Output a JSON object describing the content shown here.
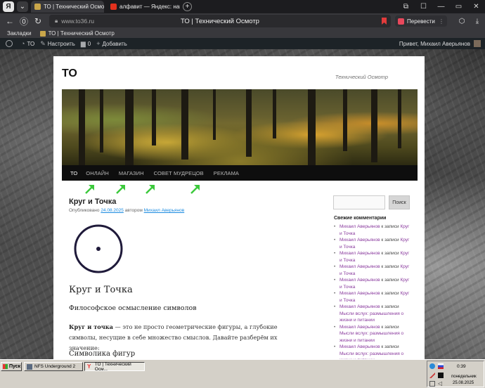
{
  "browser": {
    "tabs": [
      {
        "label": "ТО | Технический Осмотр",
        "active": true
      },
      {
        "label": "алфавит — Яндекс: нашлось",
        "active": false
      }
    ],
    "url": "www.to36.ru",
    "page_title": "ТО | Технический Осмотр",
    "translate_label": "Перевести",
    "bookmarks_label": "Закладки",
    "bookmark_item": "ТО | Технический Осмотр"
  },
  "wp_admin_bar": {
    "site_label": "ТО",
    "customize_label": "Настроить",
    "comments_count": "0",
    "new_label": "Добавить",
    "greeting": "Привет, Михаил Аверьянов"
  },
  "site": {
    "title": "ТО",
    "description": "Технический Осмотр",
    "nav": [
      "ТО",
      "ОНЛАЙН",
      "МАГАЗИН",
      "СОВЕТ МУДРЕЦОВ",
      "РЕКЛАМА"
    ]
  },
  "post": {
    "title": "Круг и Точка",
    "meta_prefix": "Опубликовано",
    "date": "24.08.2025",
    "author_prefix": "автором",
    "author": "Михаил Аверьянов",
    "heading": "Круг и Точка",
    "subheading": "Философское осмысление символов",
    "para_bold": "Круг и точка",
    "para_rest": " — это не просто геометрические фигуры, а глубокие символы, несущие в себе множество смыслов. Давайте разберём их значение:",
    "section": "Символика фигур"
  },
  "sidebar": {
    "search_button": "Поиск",
    "widget_title": "Свежие комментарии",
    "comments": [
      {
        "author": "Михаил Аверьянов",
        "sep": " к записи ",
        "post": "Круг и Точка"
      },
      {
        "author": "Михаил Аверьянов",
        "sep": " к записи ",
        "post": "Круг и Точка"
      },
      {
        "author": "Михаил Аверьянов",
        "sep": " к записи ",
        "post": "Круг и Точка"
      },
      {
        "author": "Михаил Аверьянов",
        "sep": " к записи ",
        "post": "Круг и Точка"
      },
      {
        "author": "Михаил Аверьянов",
        "sep": " к записи ",
        "post": "Круг и Точка"
      },
      {
        "author": "Михаил Аверьянов",
        "sep": " к записи ",
        "post": "Круг и Точка"
      },
      {
        "author": "Михаил Аверьянов",
        "sep": " к записи ",
        "post": "Мысли вслух: размышления о жизни и питании"
      },
      {
        "author": "Михаил Аверьянов",
        "sep": " к записи ",
        "post": "Мысли вслух: размышления о жизни и питании"
      },
      {
        "author": "Михаил Аверьянов",
        "sep": " к записи ",
        "post": "Мысли вслух: размышления о жизни и питании"
      }
    ]
  },
  "taskbar": {
    "start": "Пуск",
    "tasks": [
      "NFS Underground 2",
      "ТО | Технический Осм..."
    ],
    "time": "0:39",
    "day": "понедельник",
    "date": "25.08.2025"
  },
  "colors": {
    "accent_arrow": "#3cc93c",
    "link": "#8a3b9e",
    "meta_link": "#1b8be0"
  }
}
